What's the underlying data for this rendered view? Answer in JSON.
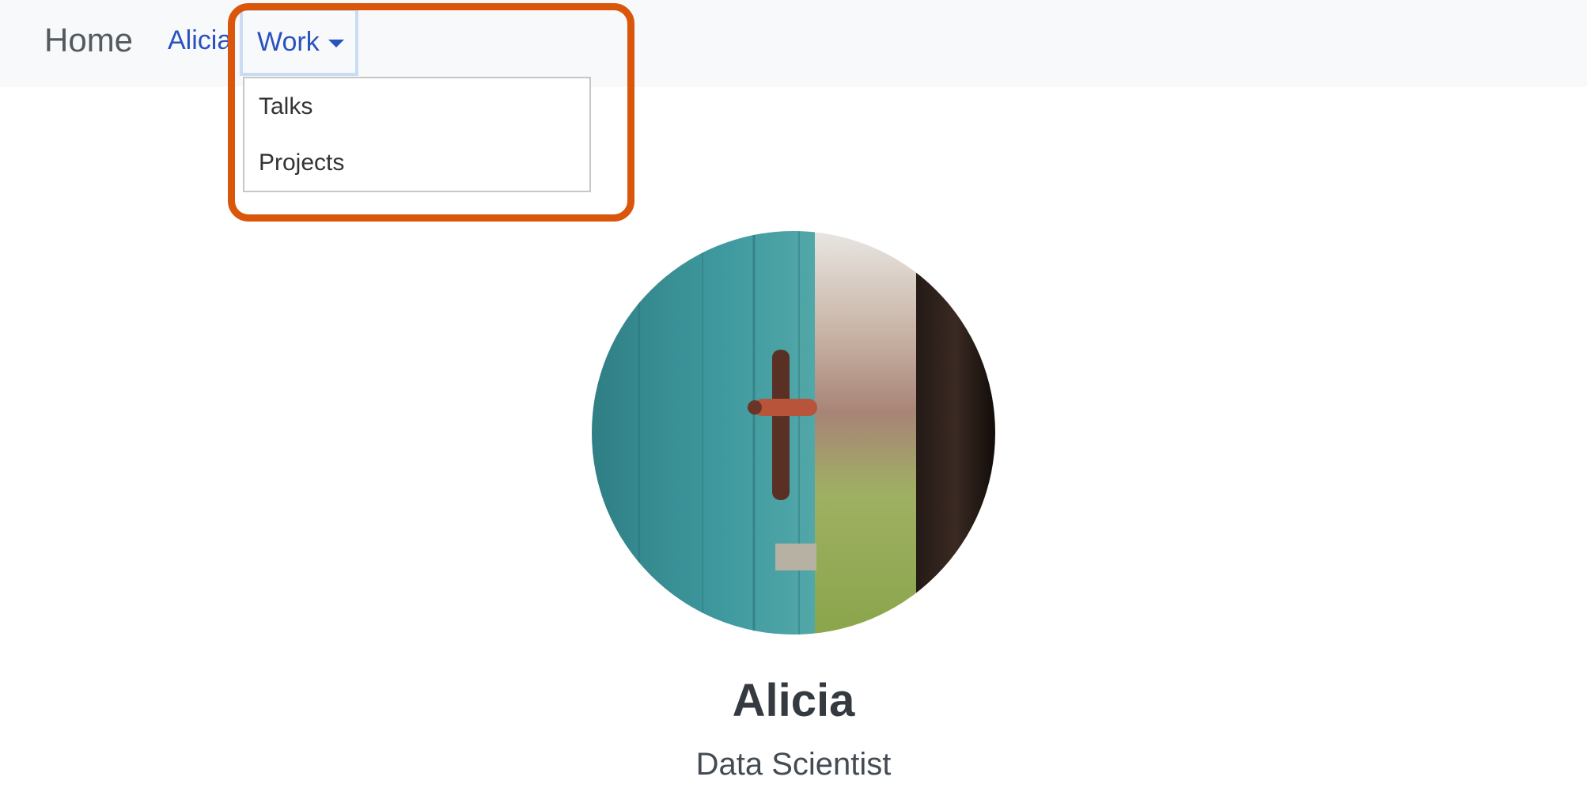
{
  "navbar": {
    "brand": "Home",
    "links": [
      {
        "label": "Alicia"
      },
      {
        "label": "Work"
      }
    ]
  },
  "dropdown": {
    "items": [
      {
        "label": "Talks"
      },
      {
        "label": "Projects"
      }
    ]
  },
  "profile": {
    "name": "Alicia",
    "role": "Data Scientist",
    "avatar_icon": "avatar-photo-open-door"
  },
  "colors": {
    "link": "#2a52be",
    "highlight": "#d9560b",
    "navbar_bg": "#f8f9fa"
  }
}
